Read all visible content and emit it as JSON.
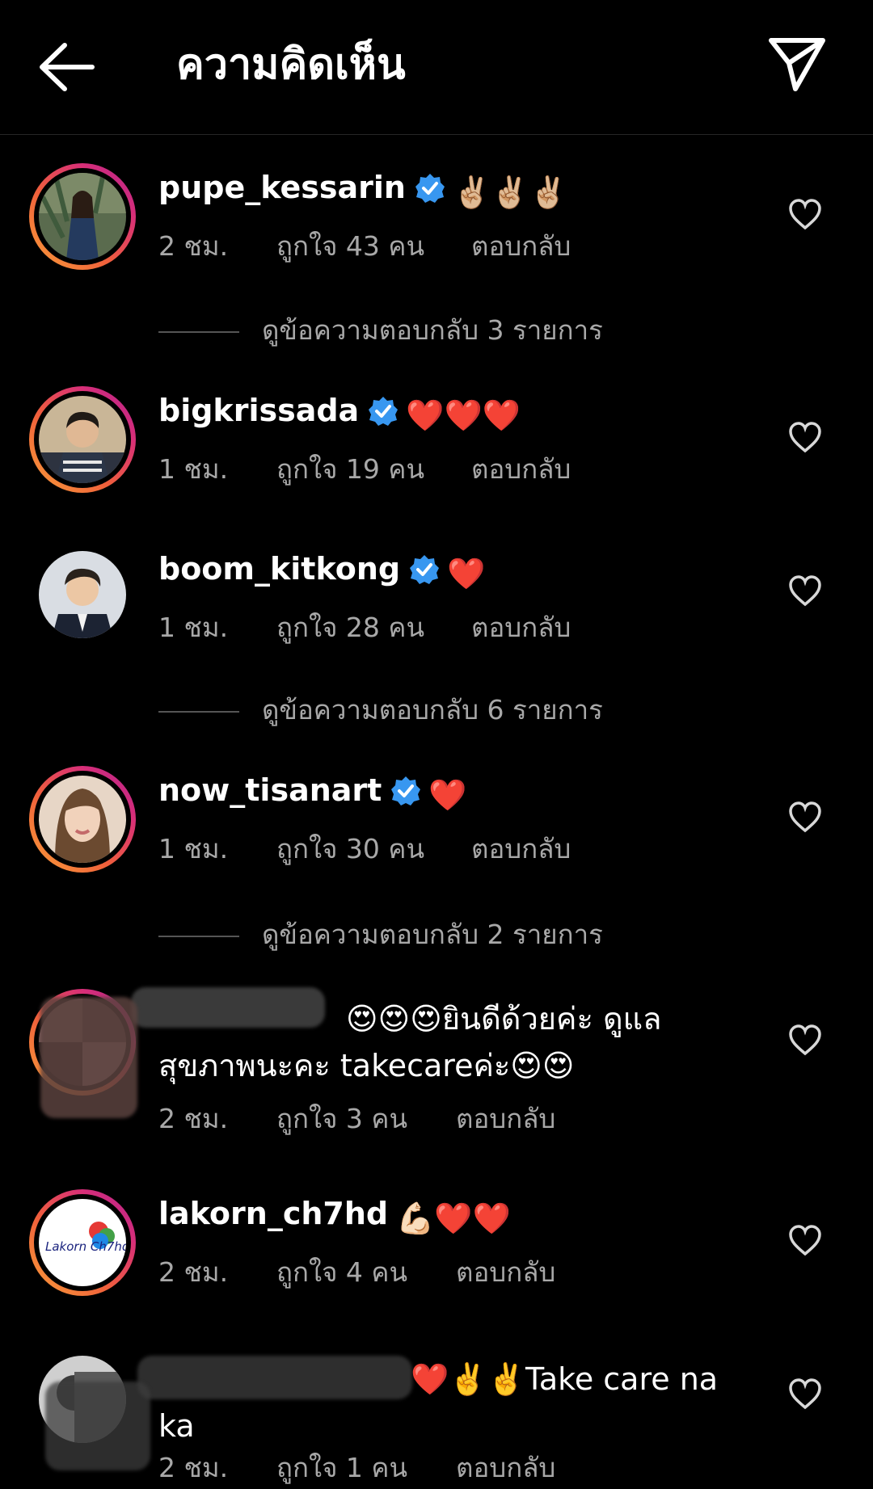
{
  "header": {
    "title": "ความคิดเห็น"
  },
  "comments": [
    {
      "username": "pupe_kessarin",
      "emoji": "✌🏼✌🏼✌🏼",
      "time": "2 ชม.",
      "likes": "ถูกใจ 43 คน",
      "reply": "ตอบกลับ",
      "view_replies": "ดูข้อความตอบกลับ 3 รายการ"
    },
    {
      "username": "bigkrissada",
      "emoji": "❤️❤️❤️",
      "time": "1 ชม.",
      "likes": "ถูกใจ 19 คน",
      "reply": "ตอบกลับ"
    },
    {
      "username": "boom_kitkong",
      "emoji": "❤️",
      "time": "1 ชม.",
      "likes": "ถูกใจ 28 คน",
      "reply": "ตอบกลับ",
      "view_replies": "ดูข้อความตอบกลับ 6 รายการ"
    },
    {
      "username": "now_tisanart",
      "emoji": "❤️",
      "time": "1 ชม.",
      "likes": "ถูกใจ 30 คน",
      "reply": "ตอบกลับ",
      "view_replies": "ดูข้อความตอบกลับ 2 รายการ"
    },
    {
      "text_line1": "😍😍😍ยินดีด้วยค่ะ ดูแล",
      "text_line2": "สุขภาพนะคะ takecareค่ะ😍😍",
      "time": "2 ชม.",
      "likes": "ถูกใจ 3 คน",
      "reply": "ตอบกลับ"
    },
    {
      "username": "lakorn_ch7hd",
      "emoji": "💪🏻❤️❤️",
      "avatar_text": "Lakorn Ch7hd",
      "time": "2 ชม.",
      "likes": "ถูกใจ 4 คน",
      "reply": "ตอบกลับ"
    },
    {
      "text_line1": "Take care na",
      "text_line2": "ka",
      "time": "2 ชม.",
      "likes": "ถูกใจ 1 คน",
      "reply": "ตอบกลับ"
    }
  ],
  "colors": {
    "background": "#000000",
    "secondary_text": "#a8a8a8",
    "verified_blue": "#3897f0",
    "heart_red": "#ed4956"
  },
  "icons": {
    "back": "arrow-left-icon",
    "send": "paper-plane-icon",
    "verified": "verified-badge-icon",
    "like": "heart-outline-icon"
  }
}
